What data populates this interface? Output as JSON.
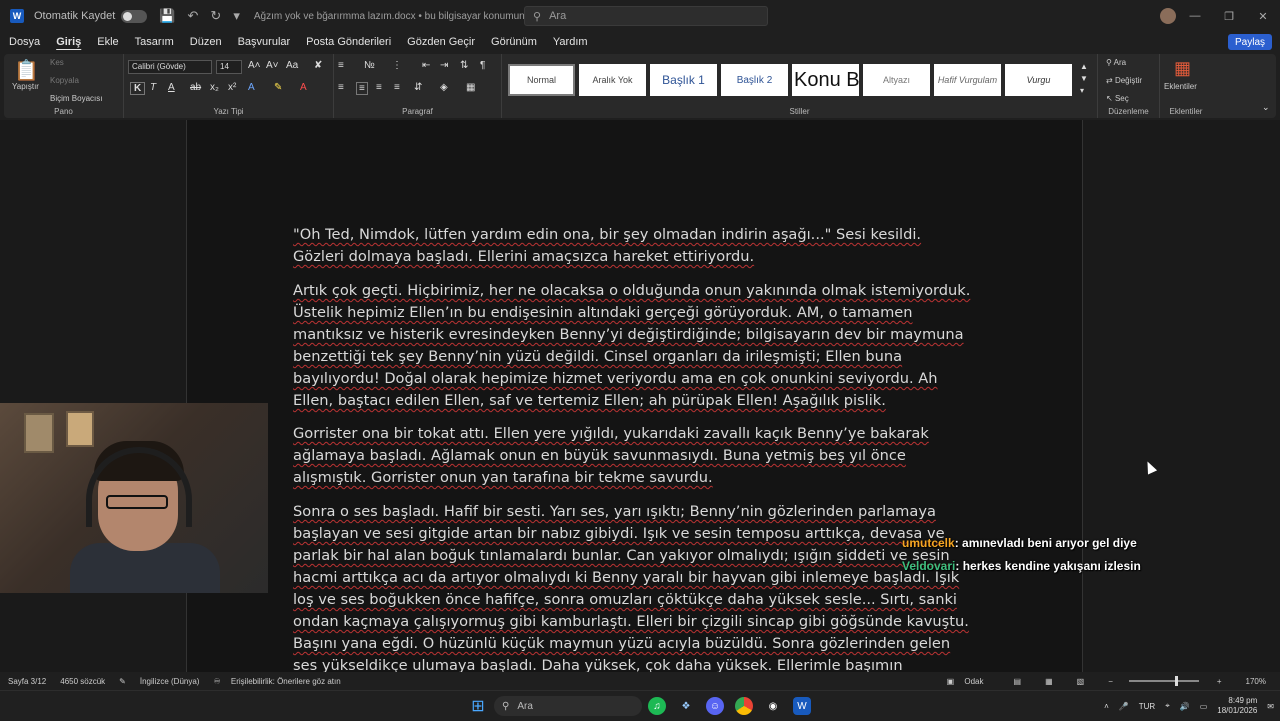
{
  "titlebar": {
    "autosave_label": "Otomatik Kaydet",
    "document_title": "Ağzım yok ve bğarırmma lazım.docx • bu bilgisayar konumuna kaydedildi",
    "search_placeholder": "Ara",
    "minimize": "—",
    "restore": "❐",
    "close": "✕"
  },
  "menu": {
    "items": [
      "Dosya",
      "Giriş",
      "Ekle",
      "Tasarım",
      "Düzen",
      "Başvurular",
      "Posta Gönderileri",
      "Gözden Geçir",
      "Görünüm",
      "Yardım"
    ],
    "share": "Paylaş"
  },
  "ribbon": {
    "clipboard": {
      "paste": "Yapıştır",
      "cut": "Kes",
      "copy": "Kopyala",
      "format_painter": "Biçim Boyacısı",
      "group": "Pano"
    },
    "font": {
      "name": "Calibri (Gövde)",
      "size": "14",
      "group": "Yazı Tipi"
    },
    "paragraph": {
      "group": "Paragraf"
    },
    "styles": {
      "items": [
        "Normal",
        "Aralık Yok",
        "Başlık 1",
        "Başlık 2",
        "Konu Başlığı",
        "Altyazı",
        "Hafif Vurgulam",
        "Vurgu"
      ],
      "group": "Stiller"
    },
    "editing": {
      "find": "Ara",
      "replace": "Değiştir",
      "select": "Seç",
      "group": "Düzenleme"
    },
    "addins": {
      "label": "Eklentiler",
      "group": "Eklentiler"
    }
  },
  "document": {
    "paragraphs": [
      "\"Oh Ted, Nimdok, lütfen yardım edin ona, bir şey olmadan indirin aşağı...\" Sesi kesildi. Gözleri dolmaya başladı. Ellerini amaçsızca hareket ettiriyordu.",
      "Artık çok geçti. Hiçbirimiz, her ne olacaksa o olduğunda onun yakınında olmak istemiyorduk. Üstelik hepimiz Ellen’ın bu endişesinin altındaki gerçeği görüyorduk. AM, o tamamen mantıksız ve histerik evresindeyken Benny’yi değiştirdiğinde; bilgisayarın dev bir maymuna benzettiği tek şey Benny’nin yüzü değildi. Cinsel organları da irileşmişti; Ellen buna bayılıyordu! Doğal olarak hepimize hizmet veriyordu ama en çok onunkini seviyordu. Ah Ellen, baştacı edilen Ellen, saf ve tertemiz Ellen; ah pürüpak Ellen! Aşağılık pislik.",
      "Gorrister ona bir tokat attı. Ellen yere yığıldı, yukarıdaki zavallı kaçık Benny’ye bakarak ağlamaya başladı. Ağlamak onun en büyük savunmasıydı. Buna yetmiş beş yıl önce alışmıştık. Gorrister onun yan tarafına bir tekme savurdu.",
      "Sonra o ses başladı. Hafif bir sesti. Yarı ses, yarı ışıktı; Benny’nin gözlerinden parlamaya başlayan ve sesi gitgide artan bir nabız gibiydi. Işık ve sesin temposu arttıkça, devasa ve parlak bir hal alan boğuk tınlamalardı bunlar. Can yakıyor olmalıydı; ışığın şiddeti ve sesin hacmi arttıkça acı da artıyor olmalıydı ki Benny yaralı bir hayvan gibi inlemeye başladı. Işık loş ve ses boğukken önce hafifçe, sonra omuzları çöktükçe daha yüksek sesle... Sırtı, sanki ondan kaçmaya çalışıyormuş gibi kamburlaştı. Elleri bir çizgili sincap gibi göğsünde kavuştu. Başını yana eğdi. O hüzünlü küçük maymun yüzü acıyla büzüldü. Sonra gözlerinden gelen ses yükseldikçe ulumaya başladı. Daha yüksek, çok daha yüksek. Ellerimle başımın yanlarına vurdum ama sesi dışarıda tutamadım, kolayca delip geçiyordu. Acı, bir dişin üzerindeki"
    ]
  },
  "chat": [
    {
      "user": "umutcelk",
      "text": ": amınevladı beni arıyor gel diye",
      "color": "#f5a623"
    },
    {
      "user": "Veldovari",
      "text": ": herkes kendine yakışanı izlesin",
      "color": "#3fbf7f"
    }
  ],
  "statusbar": {
    "page": "Sayfa 3/12",
    "words": "4650 sözcük",
    "language": "İngilizce (Dünya)",
    "accessibility": "Erişilebilirlik: Önerilere göz atın",
    "focus": "Odak",
    "zoom": "170%"
  },
  "taskbar": {
    "search": "Ara",
    "language": "TUR",
    "time": "8:49 pm",
    "date": "18/01/2026"
  }
}
